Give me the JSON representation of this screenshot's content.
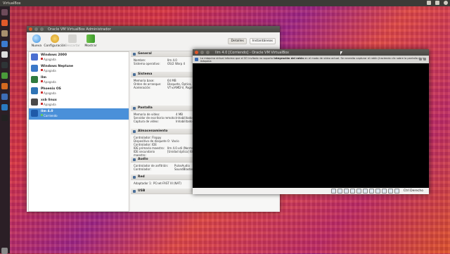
{
  "top_panel": {
    "title": "VirtualBox"
  },
  "manager": {
    "title": "Oracle VM VirtualBox Administrador",
    "toolbar": {
      "new": "Nueva",
      "settings": "Configuración",
      "discard": "Descartar",
      "show": "Mostrar",
      "details": "Detalles",
      "snapshots": "Instantáneas"
    },
    "vms": [
      {
        "name": "Windows 2000",
        "state": "Apagada",
        "color": "#4a6fd0"
      },
      {
        "name": "Windows Neptune",
        "state": "Apagada",
        "color": "#3a78c8"
      },
      {
        "name": "Ilm",
        "state": "Apagada",
        "color": "#2f7b3f"
      },
      {
        "name": "Phoenix OS",
        "state": "Apagada",
        "color": "#2f74b5"
      },
      {
        "name": "xsb linux",
        "state": "Apagada",
        "color": "#4a4a4a"
      },
      {
        "name": "Ilm 4.0",
        "state": "Corriendo",
        "color": "#1f5aa8"
      }
    ],
    "details": {
      "general": {
        "title": "General",
        "rows": [
          [
            "Nombre:",
            "Ilm 4.0"
          ],
          [
            "Sistema operativo:",
            "OS/2 Warp 4"
          ]
        ]
      },
      "system": {
        "title": "Sistema",
        "rows": [
          [
            "Memoria base:",
            "64 MB"
          ],
          [
            "Orden de arranque:",
            "Disquete, Óptica, Disco duro"
          ],
          [
            "Aceleración:",
            "VT-x/AMD-V, Paginación anidada"
          ]
        ]
      },
      "display": {
        "title": "Pantalla",
        "rows": [
          [
            "Memoria de vídeo:",
            "4 MB"
          ],
          [
            "Servidor de escritorio remoto:",
            "Inhabilitado"
          ],
          [
            "Captura de vídeo:",
            "Inhabilitado"
          ]
        ]
      },
      "storage": {
        "title": "Almacenamiento",
        "rows": [
          [
            "Controlador: Floppy",
            ""
          ],
          [
            "  Dispositivo de disquete 0:",
            "Vacío"
          ],
          [
            "Controlador: IDE",
            ""
          ],
          [
            "  IDE primario maestro:",
            "Ilm 4.0.vdi (Normal, 2.00 GB)"
          ],
          [
            "  IDE secundario maestro:",
            "[Unidad óptica] IBM_OS2_Warp_4.iso (338"
          ]
        ]
      },
      "audio": {
        "title": "Audio",
        "rows": [
          [
            "Controlador de anfitrión:",
            "PulseAudio"
          ],
          [
            "Controlador:",
            "SoundBlaster 16"
          ]
        ]
      },
      "network": {
        "title": "Red",
        "rows": [
          [
            "Adaptador 1:",
            "PCnet-FAST III (NAT)"
          ]
        ]
      },
      "usb": {
        "title": "USB",
        "rows": []
      }
    }
  },
  "vm_window": {
    "title": "Ilm 4.0 [Corriendo] - Oracle VM VirtualBox",
    "notice_pre": "La máquina virtual informa que el SO invitado no soporta ",
    "notice_bold": "integración del ratón",
    "notice_post": " en el modo de vídeo actual. Se necesita capturar el ratón (haciendo clic sobre la pantalla de la máquina",
    "host_key": "Ctrl Derecho"
  },
  "colors": {
    "selection": "#4a90d9",
    "titlebar": "#4f4e4a"
  }
}
